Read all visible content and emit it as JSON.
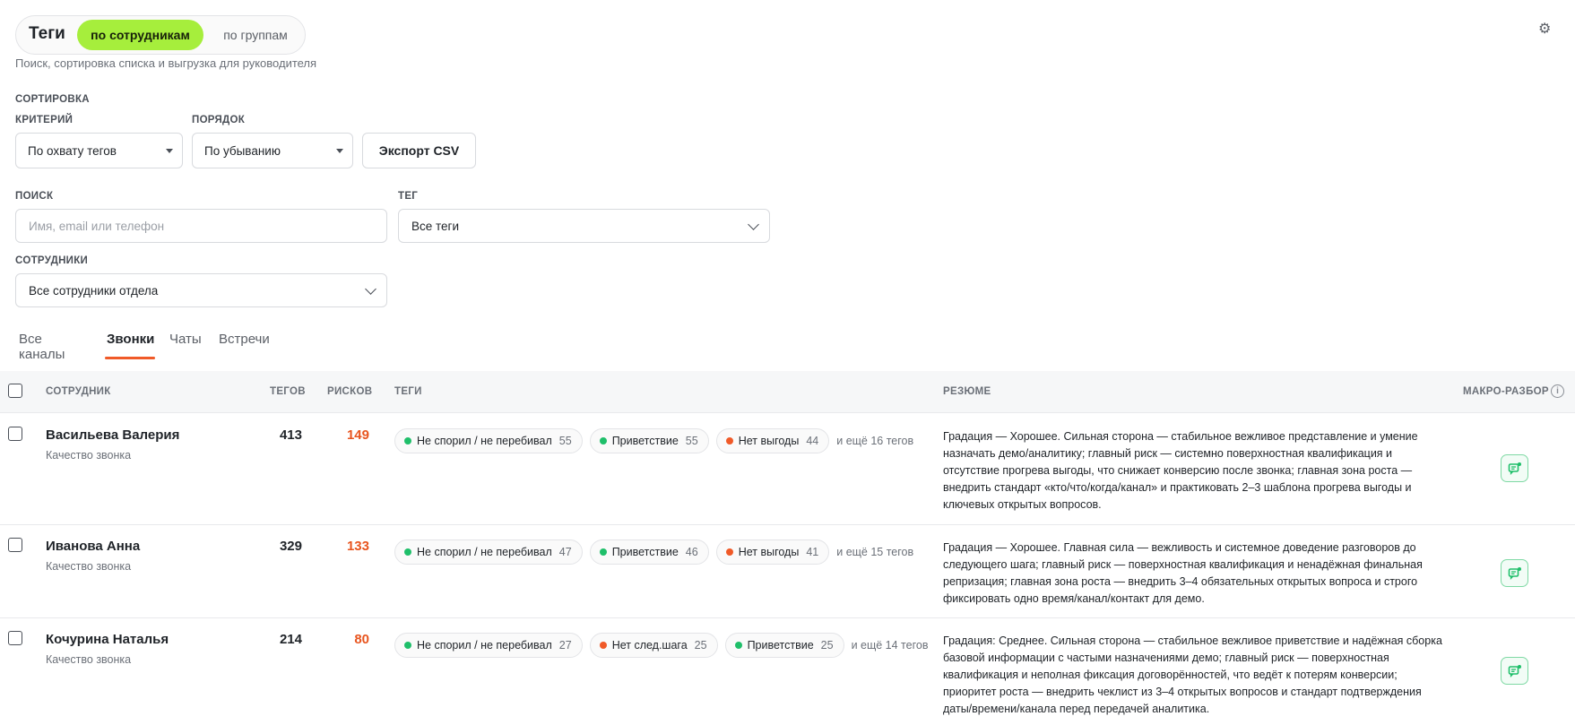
{
  "header": {
    "title": "Теги",
    "segments": [
      "по сотрудникам",
      "по группам"
    ],
    "subtitle": "Поиск, сортировка списка и выгрузка для руководителя"
  },
  "sorting": {
    "section_label": "СОРТИРОВКА",
    "criterion_label": "КРИТЕРИЙ",
    "criterion_value": "По охвату тегов",
    "order_label": "ПОРЯДОК",
    "order_value": "По убыванию",
    "export_label": "Экспорт CSV"
  },
  "filters": {
    "search_label": "ПОИСК",
    "search_placeholder": "Имя, email или телефон",
    "tag_label": "ТЕГ",
    "tag_value": "Все теги",
    "employees_label": "СОТРУДНИКИ",
    "employees_value": "Все сотрудники отдела"
  },
  "tabs": [
    "Все каналы",
    "Звонки",
    "Чаты",
    "Встречи"
  ],
  "active_tab": "Звонки",
  "table": {
    "columns": {
      "employee": "СОТРУДНИК",
      "tags_count": "ТЕГОВ",
      "risks": "РИСКОВ",
      "tags": "ТЕГИ",
      "summary": "РЕЗЮМЕ",
      "macro": "МАКРО-РАЗБОР"
    },
    "rows": [
      {
        "name": "Васильева Валерия",
        "subtitle": "Качество звонка",
        "tags_count": "413",
        "risks": "149",
        "chips": [
          {
            "label": "Не спорил / не перебивал",
            "count": "55",
            "status": "green"
          },
          {
            "label": "Приветствие",
            "count": "55",
            "status": "green"
          },
          {
            "label": "Нет выгоды",
            "count": "44",
            "status": "red"
          }
        ],
        "more": "и ещё 16 тегов",
        "summary": "Градация — Хорошее. Сильная сторона — стабильное вежливое представление и умение назначать демо/аналитику; главный риск — системно поверхностная квалификация и отсутствие прогрева выгоды, что снижает конверсию после звонка; главная зона роста — внедрить стандарт «кто/что/когда/канал» и практиковать 2–3 шаблона прогрева выгоды и ключевых открытых вопросов."
      },
      {
        "name": "Иванова Анна",
        "subtitle": "Качество звонка",
        "tags_count": "329",
        "risks": "133",
        "chips": [
          {
            "label": "Не спорил / не перебивал",
            "count": "47",
            "status": "green"
          },
          {
            "label": "Приветствие",
            "count": "46",
            "status": "green"
          },
          {
            "label": "Нет выгоды",
            "count": "41",
            "status": "red"
          }
        ],
        "more": "и ещё 15 тегов",
        "summary": "Градация — Хорошее. Главная сила — вежливость и системное доведение разговоров до следующего шага; главный риск — поверхностная квалификация и ненадёжная финальная репризация; главная зона роста — внедрить 3–4 обязательных открытых вопроса и строго фиксировать одно время/канал/контакт для демо."
      },
      {
        "name": "Кочурина Наталья",
        "subtitle": "Качество звонка",
        "tags_count": "214",
        "risks": "80",
        "chips": [
          {
            "label": "Не спорил / не перебивал",
            "count": "27",
            "status": "green"
          },
          {
            "label": "Нет след.шага",
            "count": "25",
            "status": "red"
          },
          {
            "label": "Приветствие",
            "count": "25",
            "status": "green"
          }
        ],
        "more": "и ещё 14 тегов",
        "summary": "Градация: Среднее. Сильная сторона — стабильное вежливое приветствие и надёжная сборка базовой информации с частыми назначениями демо; главный риск — поверхностная квалификация и неполная фиксация договорённостей, что ведёт к потерям конверсии; приоритет роста — внедрить чеклист из 3–4 открытых вопросов и стандарт подтверждения даты/времени/канала перед передачей аналитика."
      }
    ]
  },
  "colors": {
    "accent_green": "#a6ee3c",
    "risk_orange": "#e8551f",
    "tab_underline": "#f05a28",
    "chip_green": "#1fbf6a",
    "chip_red": "#f05a28"
  },
  "icons": {
    "settings": "gear-icon",
    "macro": "chat-icon",
    "info": "info-icon"
  }
}
